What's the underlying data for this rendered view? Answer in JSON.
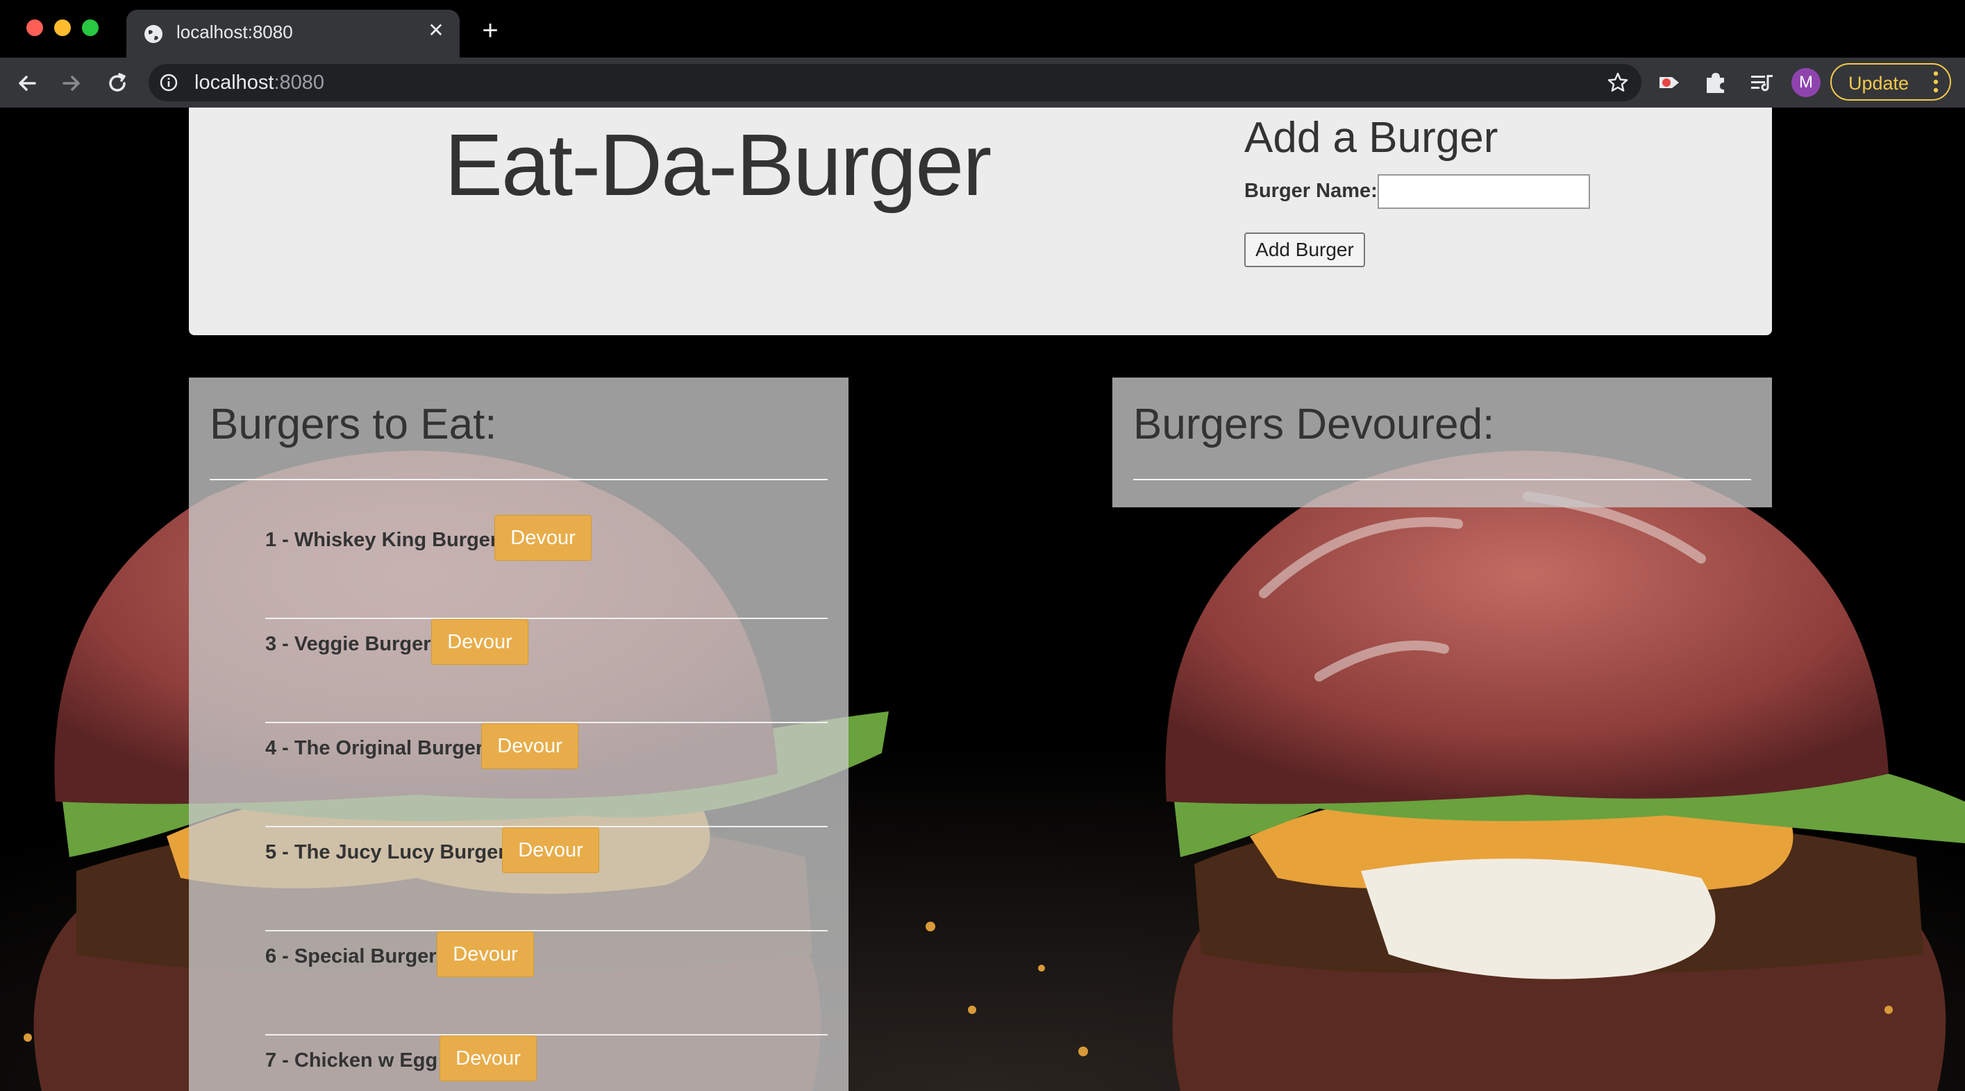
{
  "browser": {
    "tab_title": "localhost:8080",
    "new_tab_icon": "plus-icon",
    "url_host": "localhost",
    "url_port": ":8080",
    "profile_initial": "M",
    "update_label": "Update"
  },
  "header": {
    "title": "Eat-Da-Burger",
    "add_title": "Add a Burger",
    "name_label": "Burger Name:",
    "name_value": "",
    "add_button": "Add Burger"
  },
  "to_eat": {
    "heading": "Burgers to Eat:",
    "items": [
      {
        "label": "1 - Whiskey King Burger",
        "button": "Devour"
      },
      {
        "label": "3 - Veggie Burger",
        "button": "Devour"
      },
      {
        "label": "4 - The Original Burger",
        "button": "Devour"
      },
      {
        "label": "5 - The Jucy Lucy Burger",
        "button": "Devour"
      },
      {
        "label": "6 - Special Burger",
        "button": "Devour"
      },
      {
        "label": "7 - Chicken w Egg",
        "button": "Devour"
      }
    ]
  },
  "devoured": {
    "heading": "Burgers Devoured:"
  },
  "colors": {
    "devour_button": "#e8ad4a",
    "update_accent": "#f2c94c",
    "avatar": "#8e44ad"
  }
}
